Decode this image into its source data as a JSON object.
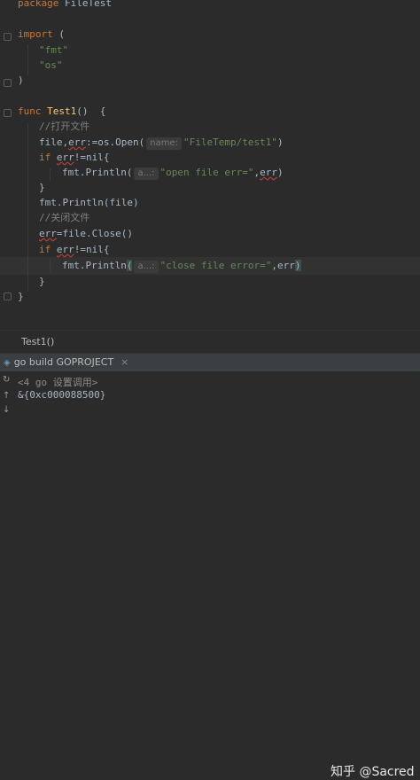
{
  "editor": {
    "l1_kw": "package",
    "l1_name": "FileTest",
    "l2_kw": "import",
    "l2_open": "(",
    "l3": "\"fmt\"",
    "l4": "\"os\"",
    "l5": ")",
    "l6_kw": "func",
    "l6_fn": "Test1",
    "l6_rest": "()  {",
    "l7": "//打开文件",
    "l8_a": "file,",
    "l8_err": "err",
    "l8_b": ":=os.Open(",
    "l8_hint": "name:",
    "l8_str": "\"FileTemp/test1\"",
    "l8_c": ")",
    "l9_kw": "if",
    "l9_err": "err",
    "l9_rest": "!=nil{",
    "l10_a": "fmt.Println(",
    "l10_hint": "a...:",
    "l10_str": "\"open file err=\"",
    "l10_b": ",",
    "l10_err": "err",
    "l10_c": ")",
    "l11": "}",
    "l12": "fmt.Println(file)",
    "l13": "//关闭文件",
    "l14_err": "err",
    "l14_rest": "=file.Close()",
    "l15_kw": "if",
    "l15_err": "err",
    "l15_rest": "!=nil{",
    "l16_a": "fmt.Println",
    "l16_open": "(",
    "l16_hint": "a...:",
    "l16_str": "\"close file error=\"",
    "l16_b": ",err",
    "l16_close": ")",
    "l17": "}",
    "l18": "}"
  },
  "breadcrumb": {
    "label": "Test1()"
  },
  "run_panel": {
    "tab_label": "go build GOPROJECT",
    "tab_close": "×",
    "console_line1": "<4 go 设置调用>",
    "console_line2": "&{0xc000088500}"
  },
  "watermark": "知乎 @Sacred"
}
